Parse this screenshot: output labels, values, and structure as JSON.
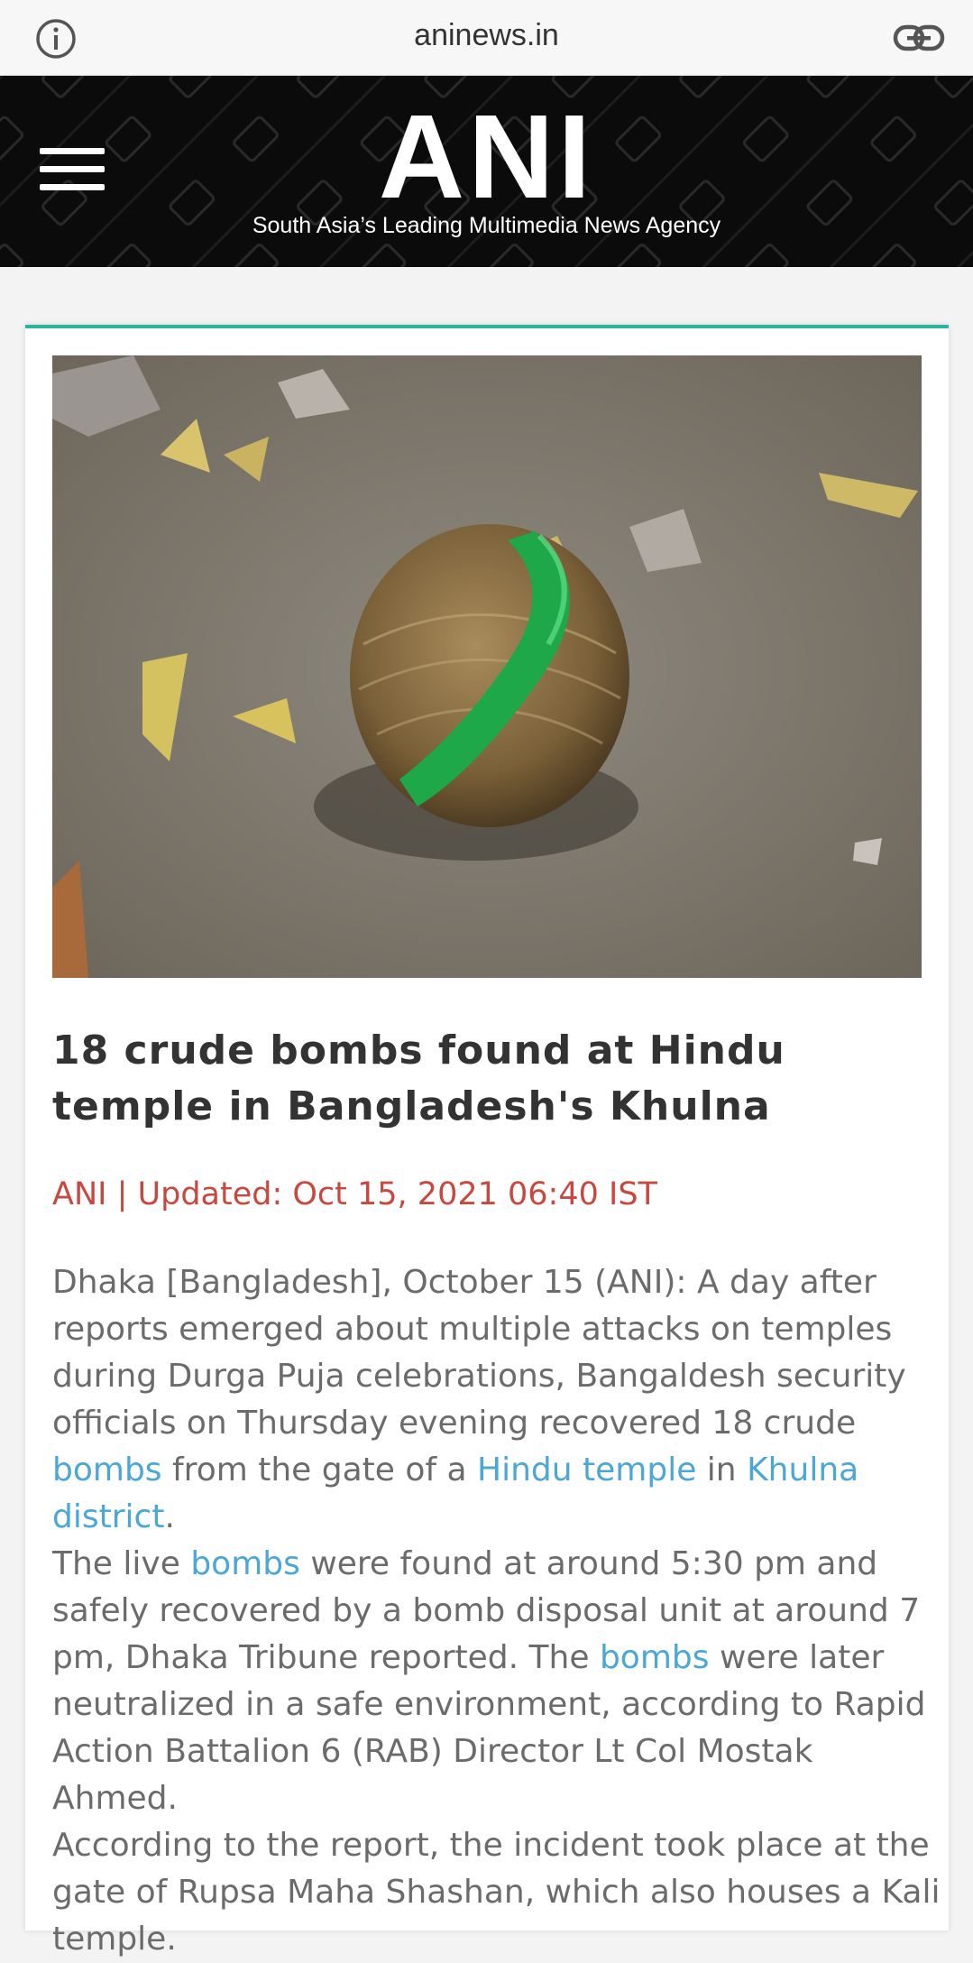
{
  "browser": {
    "domain": "aninews.in",
    "icons": {
      "info": "info-icon",
      "share": "link-icon"
    }
  },
  "header": {
    "logo": "ANI",
    "tagline": "South Asia’s Leading Multimedia News Agency",
    "menu_icon": "hamburger-menu-icon",
    "background_color": "#0b0b0b"
  },
  "article": {
    "image_description": "crude bomb photo",
    "title": "18 crude bombs found at Hindu temple in Bangladesh's Khulna",
    "byline": "ANI | Updated: Oct 15, 2021 06:40 IST",
    "p1": {
      "t1": "Dhaka [Bangladesh], October 15 (ANI): A day after reports emerged about multiple attacks on temples during Durga Puja celebrations, Bangaldesh security officials on Thursday evening recovered 18 crude ",
      "l1": "bombs",
      "t2": " from the gate of a ",
      "l2": "Hindu temple",
      "t3": " in ",
      "l3": "Khulna district",
      "t4": "."
    },
    "p2": {
      "t1": "The live ",
      "l1": "bombs",
      "t2": " were found at around 5:30 pm and safely recovered by a bomb disposal unit at around 7 pm, Dhaka Tribune reported. The ",
      "l2": "bombs",
      "t3": " were later neutralized in a safe environment, according to Rapid Action Battalion 6 (RAB) Director Lt Col Mostak Ahmed."
    },
    "p3": "According to the report, the incident took place at the gate of Rupsa Maha Shashan, which also houses a Kali temple."
  },
  "colors": {
    "accent_teal": "#2bb5a1",
    "byline_red": "#c9473e",
    "link_blue": "#4ba7d6"
  }
}
